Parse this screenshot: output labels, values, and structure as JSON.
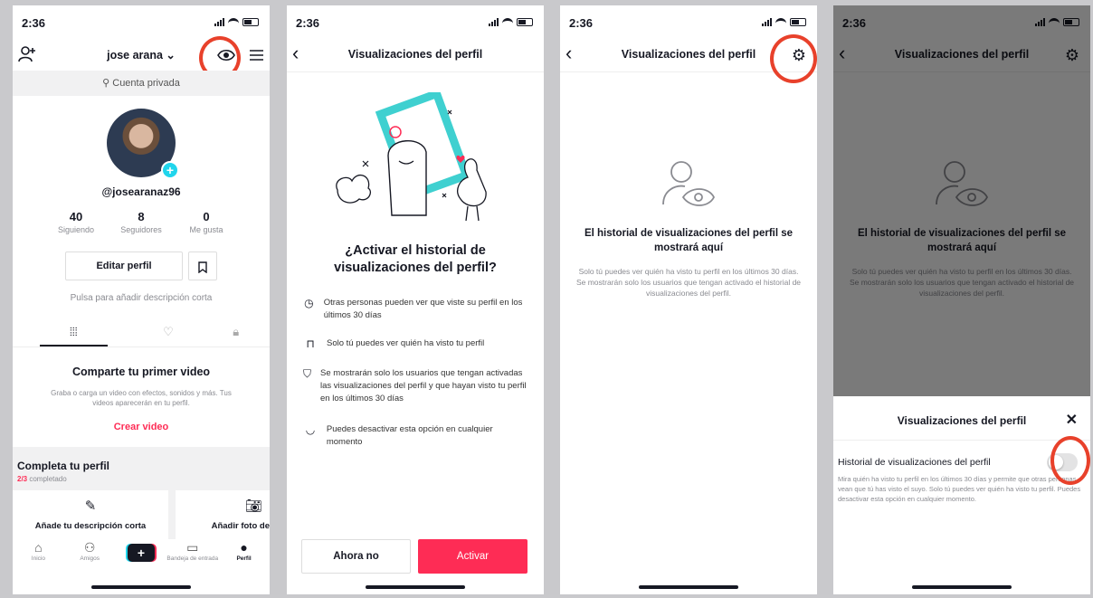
{
  "status": {
    "time": "2:36"
  },
  "profile": {
    "username": "jose arana",
    "chevron": "⌄",
    "private_label": "Cuenta privada",
    "handle": "@josearanaz96",
    "stats": [
      {
        "value": "40",
        "label": "Siguiendo"
      },
      {
        "value": "8",
        "label": "Seguidores"
      },
      {
        "value": "0",
        "label": "Me gusta"
      }
    ],
    "edit_label": "Editar perfil",
    "bio_hint": "Pulsa para añadir descripción corta",
    "share_title": "Comparte tu primer video",
    "share_sub": "Graba o carga un video con efectos, sonidos y más. Tus videos aparecerán en tu perfil.",
    "create_label": "Crear video",
    "complete_title": "Completa tu perfil",
    "complete_progress": "2/3",
    "complete_suffix": " completado",
    "cards": [
      "Añade tu descripción corta",
      "Añadir foto de"
    ],
    "tabbar": [
      "Inicio",
      "Amigos",
      "+",
      "Bandeja de entrada",
      "Perfil"
    ]
  },
  "onboarding": {
    "title": "Visualizaciones del perfil",
    "question": "¿Activar el historial de visualizaciones del perfil?",
    "features": [
      "Otras personas pueden ver que viste su perfil en los últimos 30 días",
      "Solo tú puedes ver quién ha visto tu perfil",
      "Se mostrarán solo los usuarios que tengan activadas las visualizaciones del perfil y que hayan visto tu perfil en los últimos 30 días",
      "Puedes desactivar esta opción en cualquier momento"
    ],
    "btn_no": "Ahora no",
    "btn_yes": "Activar"
  },
  "views": {
    "title": "Visualizaciones del perfil",
    "empty_title": "El historial de visualizaciones del perfil se mostrará aquí",
    "empty_sub": "Solo tú puedes ver quién ha visto tu perfil en los últimos 30 días. Se mostrarán solo los usuarios que tengan activado el historial de visualizaciones del perfil."
  },
  "settings_sheet": {
    "title": "Visualizaciones del perfil",
    "setting_label": "Historial de visualizaciones del perfil",
    "setting_desc": "Mira quién ha visto tu perfil en los últimos 30 días y permite que otras personas vean que tú has visto el suyo. Solo tú puedes ver quién ha visto tu perfil. Puedes desactivar esta opción en cualquier momento.",
    "toggle_on": false
  },
  "colors": {
    "accent": "#fe2c55",
    "teal": "#20d5ec",
    "annotation": "#e8412b"
  }
}
